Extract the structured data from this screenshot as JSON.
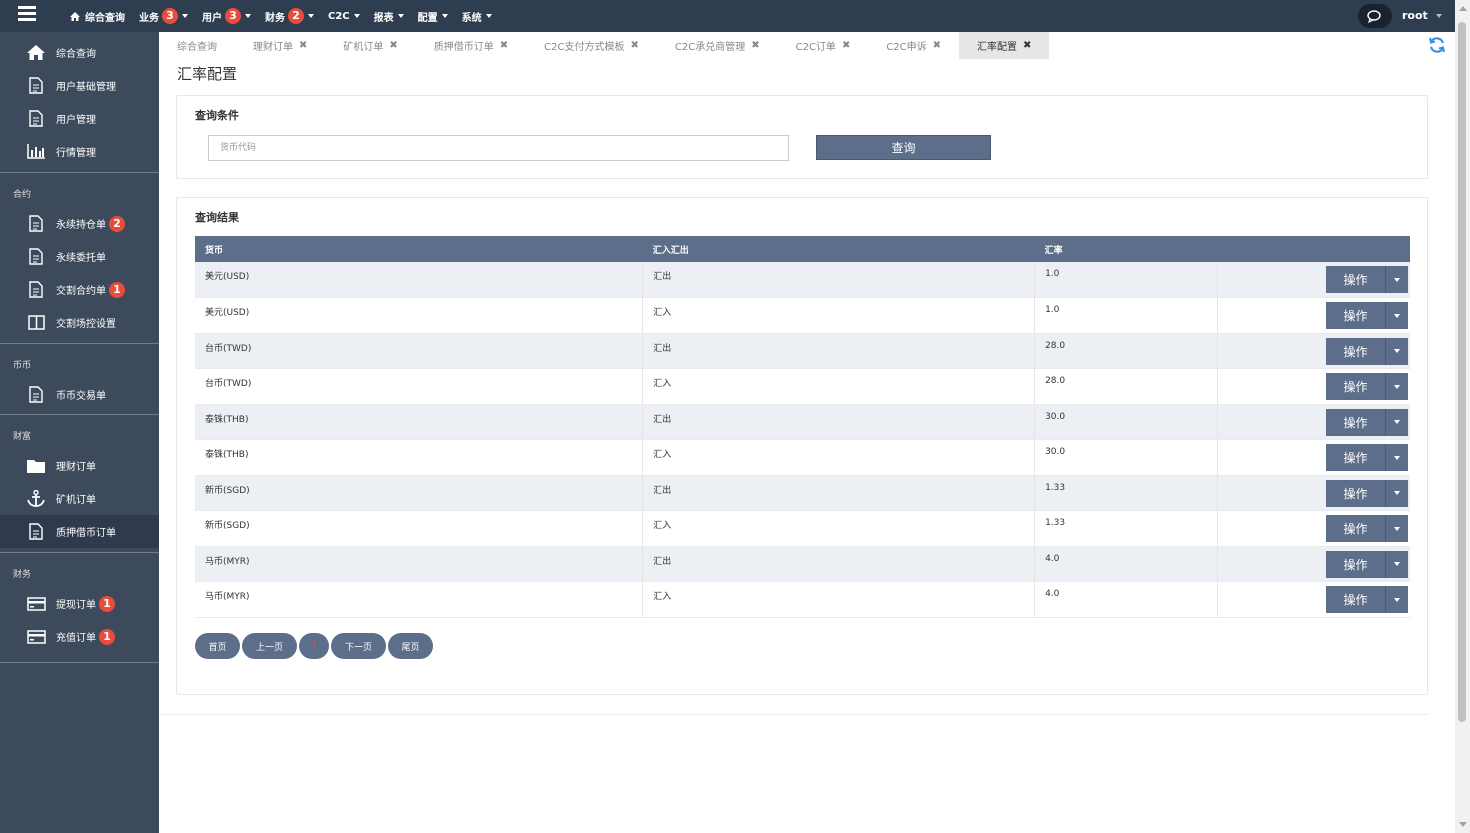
{
  "topnav": {
    "items": [
      {
        "label": "综合查询",
        "icon": "home-icon"
      },
      {
        "label": "业务",
        "badge": "3"
      },
      {
        "label": "用户",
        "badge": "3"
      },
      {
        "label": "财务",
        "badge": "2"
      },
      {
        "label": "C2C"
      },
      {
        "label": "报表"
      },
      {
        "label": "配置"
      },
      {
        "label": "系统"
      }
    ],
    "user": "root"
  },
  "sidebar": {
    "group1": [
      {
        "label": "综合查询",
        "icon": "home-icon"
      },
      {
        "label": "用户基础管理",
        "icon": "document-icon"
      },
      {
        "label": "用户管理",
        "icon": "document-icon"
      },
      {
        "label": "行情管理",
        "icon": "bar-chart-icon"
      }
    ],
    "section2": "合约",
    "group2": [
      {
        "label": "永续持仓单",
        "icon": "document-icon",
        "badge": "2"
      },
      {
        "label": "永续委托单",
        "icon": "document-icon"
      },
      {
        "label": "交割合约单",
        "icon": "document-icon",
        "badge": "1"
      },
      {
        "label": "交割场控设置",
        "icon": "columns-icon"
      }
    ],
    "section3": "币币",
    "group3": [
      {
        "label": "币币交易单",
        "icon": "document-icon"
      }
    ],
    "section4": "财富",
    "group4": [
      {
        "label": "理财订单",
        "icon": "folder-icon"
      },
      {
        "label": "矿机订单",
        "icon": "anchor-icon"
      },
      {
        "label": "质押借币订单",
        "icon": "document-icon"
      }
    ],
    "section5": "财务",
    "group5": [
      {
        "label": "提现订单",
        "icon": "credit-card-icon",
        "badge": "1"
      },
      {
        "label": "充值订单",
        "icon": "credit-card-icon",
        "badge": "1"
      }
    ]
  },
  "tabs": [
    {
      "label": "综合查询",
      "closable": false
    },
    {
      "label": "理财订单",
      "closable": true
    },
    {
      "label": "矿机订单",
      "closable": true
    },
    {
      "label": "质押借币订单",
      "closable": true
    },
    {
      "label": "C2C支付方式模板",
      "closable": true
    },
    {
      "label": "C2C承兑商管理",
      "closable": true
    },
    {
      "label": "C2C订单",
      "closable": true
    },
    {
      "label": "C2C申诉",
      "closable": true
    },
    {
      "label": "汇率配置",
      "closable": true,
      "active": true
    }
  ],
  "page": {
    "title": "汇率配置",
    "query_panel_title": "查询条件",
    "search_placeholder": "货币代码",
    "search_button": "查询",
    "result_panel_title": "查询结果"
  },
  "table": {
    "headers": [
      "货币",
      "汇入汇出",
      "汇率",
      ""
    ],
    "action_label": "操作",
    "rows": [
      {
        "currency": "美元(USD)",
        "direction": "汇出",
        "rate": "1.0"
      },
      {
        "currency": "美元(USD)",
        "direction": "汇入",
        "rate": "1.0"
      },
      {
        "currency": "台币(TWD)",
        "direction": "汇出",
        "rate": "28.0"
      },
      {
        "currency": "台币(TWD)",
        "direction": "汇入",
        "rate": "28.0"
      },
      {
        "currency": "泰铢(THB)",
        "direction": "汇出",
        "rate": "30.0"
      },
      {
        "currency": "泰铢(THB)",
        "direction": "汇入",
        "rate": "30.0"
      },
      {
        "currency": "新币(SGD)",
        "direction": "汇出",
        "rate": "1.33"
      },
      {
        "currency": "新币(SGD)",
        "direction": "汇入",
        "rate": "1.33"
      },
      {
        "currency": "马币(MYR)",
        "direction": "汇出",
        "rate": "4.0"
      },
      {
        "currency": "马币(MYR)",
        "direction": "汇入",
        "rate": "4.0"
      }
    ]
  },
  "pager": {
    "first": "首页",
    "prev": "上一页",
    "current": "1",
    "next": "下一页",
    "last": "尾页"
  },
  "colors": {
    "topbar": "#2f3d50",
    "sidebar": "#3d4a5c",
    "accent": "#5c6e89",
    "badge": "#e74c3c"
  }
}
